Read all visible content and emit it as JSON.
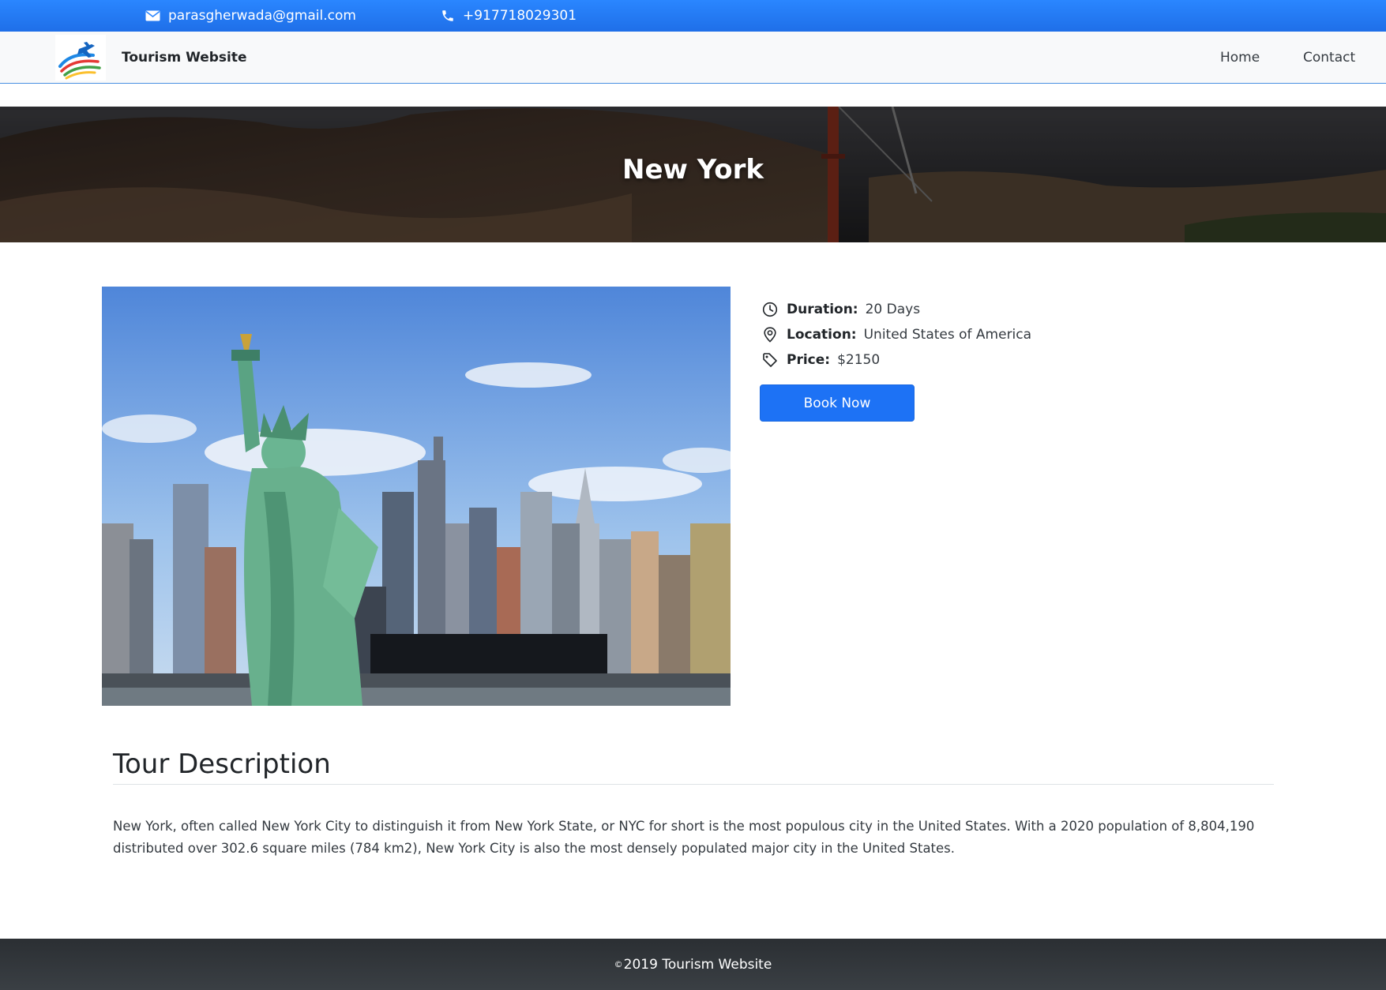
{
  "topbar": {
    "email": "parasgherwada@gmail.com",
    "phone": "+917718029301"
  },
  "navbar": {
    "brand": "Tourism Website",
    "links": [
      "Home",
      "Contact"
    ]
  },
  "banner": {
    "title": "New York"
  },
  "tour": {
    "details": [
      {
        "icon": "clock-icon",
        "label": "Duration:",
        "value": "20 Days"
      },
      {
        "icon": "location-pin-icon",
        "label": "Location:",
        "value": "United States of America"
      },
      {
        "icon": "price-tag-icon",
        "label": "Price:",
        "value": "$2150"
      }
    ],
    "book_label": "Book Now"
  },
  "description": {
    "title": "Tour Description",
    "text": "New York, often called New York City to distinguish it from New York State, or NYC for short is the most populous city in the United States. With a 2020 population of 8,804,190 distributed over 302.6 square miles (784 km2), New York City is also the most densely populated major city in the United States."
  },
  "footer": {
    "copyright_symbol": "©",
    "text": "2019 Tourism Website"
  },
  "colors": {
    "topbar": "#2a86ff",
    "button": "#1d72f5",
    "footer": "#343a40"
  }
}
